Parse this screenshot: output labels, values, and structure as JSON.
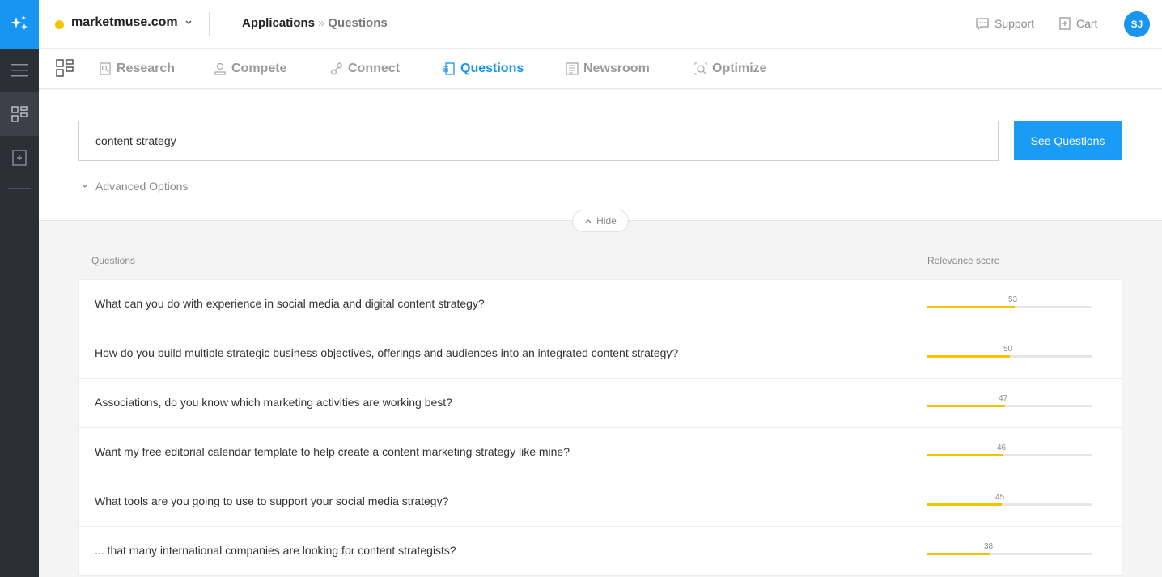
{
  "header": {
    "site": "marketmuse.com",
    "breadcrumb": [
      "Applications",
      "»",
      "Questions"
    ],
    "support_label": "Support",
    "cart_label": "Cart",
    "avatar_initials": "SJ"
  },
  "tabs": [
    {
      "label": "Research",
      "icon": "research-icon"
    },
    {
      "label": "Compete",
      "icon": "compete-icon"
    },
    {
      "label": "Connect",
      "icon": "connect-icon"
    },
    {
      "label": "Questions",
      "icon": "questions-icon",
      "active": true
    },
    {
      "label": "Newsroom",
      "icon": "newsroom-icon"
    },
    {
      "label": "Optimize",
      "icon": "optimize-icon"
    }
  ],
  "search": {
    "value": "content strategy",
    "button_label": "See Questions",
    "advanced_label": "Advanced Options",
    "hide_label": "Hide"
  },
  "results": {
    "col_question": "Questions",
    "col_score": "Relevance score",
    "rows": [
      {
        "question": "What can you do with experience in social media and digital content strategy?",
        "score": 53
      },
      {
        "question": "How do you build multiple strategic business objectives, offerings and audiences into an integrated content strategy?",
        "score": 50
      },
      {
        "question": "Associations, do you know which marketing activities are working best?",
        "score": 47
      },
      {
        "question": "Want my free editorial calendar template to help create a content marketing strategy like mine?",
        "score": 46
      },
      {
        "question": "What tools are you going to use to support your social media strategy?",
        "score": 45
      },
      {
        "question": "... that many international companies are looking for content strategists?",
        "score": 38
      }
    ]
  },
  "colors": {
    "accent": "#1795f0",
    "bar_fill": "#f5c400",
    "rail": "#2b2f36"
  }
}
